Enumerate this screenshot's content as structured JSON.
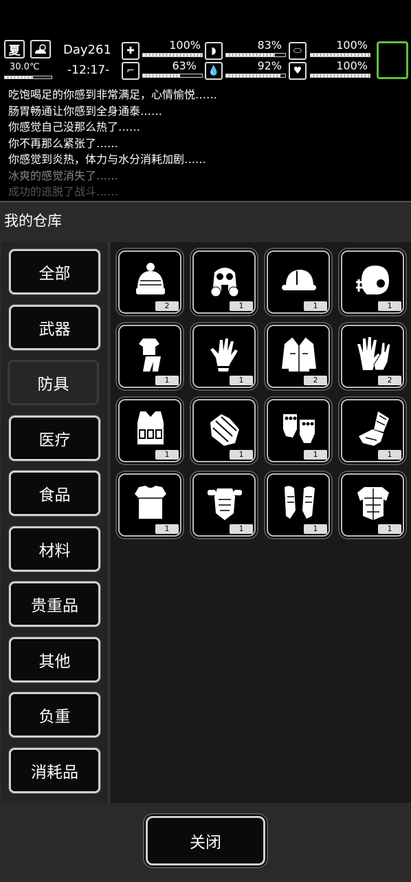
{
  "status": {
    "season": "夏",
    "temperature": "30.0℃",
    "day": "Day261",
    "time": "-12:17-",
    "stats": [
      {
        "name": "health-icon",
        "value": "100%",
        "level": 1.0
      },
      {
        "name": "stomach-icon",
        "value": "83%",
        "level": 0.83
      },
      {
        "name": "pill-icon",
        "value": "100%",
        "level": 1.0
      },
      {
        "name": "foot-icon",
        "value": "63%",
        "level": 0.63
      },
      {
        "name": "water-drop-icon",
        "value": "92%",
        "level": 0.92
      },
      {
        "name": "heart-icon",
        "value": "100%",
        "level": 1.0
      }
    ]
  },
  "log": [
    "吃饱喝足的你感到非常满足，心情愉悦……",
    "肠胃畅通让你感到全身通泰……",
    "你感觉自己没那么热了……",
    "你不再那么紧张了……",
    "你感觉到炎热，体力与水分消耗加剧……",
    "冰爽的感觉消失了……",
    "成功的逃脱了战斗……"
  ],
  "panel": {
    "title": "我的仓库",
    "categories": [
      "全部",
      "武器",
      "防具",
      "医疗",
      "食品",
      "材料",
      "贵重品",
      "其他",
      "负重",
      "消耗品"
    ],
    "active_category": "防具",
    "close_label": "关闭"
  },
  "items": [
    {
      "name": "knit-hat-icon",
      "count": "2"
    },
    {
      "name": "gas-mask-icon",
      "count": "1"
    },
    {
      "name": "hard-hat-icon",
      "count": "1"
    },
    {
      "name": "football-helmet-icon",
      "count": "1"
    },
    {
      "name": "pajamas-icon",
      "count": "1"
    },
    {
      "name": "thin-glove-icon",
      "count": "1"
    },
    {
      "name": "jacket-icon",
      "count": "2"
    },
    {
      "name": "work-gloves-icon",
      "count": "2"
    },
    {
      "name": "tactical-vest-icon",
      "count": "1"
    },
    {
      "name": "tactical-gloves-icon",
      "count": "1"
    },
    {
      "name": "fingerless-gloves-icon",
      "count": "1"
    },
    {
      "name": "armored-gauntlet-icon",
      "count": "1"
    },
    {
      "name": "chest-guard-icon",
      "count": "1"
    },
    {
      "name": "body-armor-icon",
      "count": "1"
    },
    {
      "name": "leg-guards-icon",
      "count": "1"
    },
    {
      "name": "plate-armor-icon",
      "count": "1"
    }
  ]
}
